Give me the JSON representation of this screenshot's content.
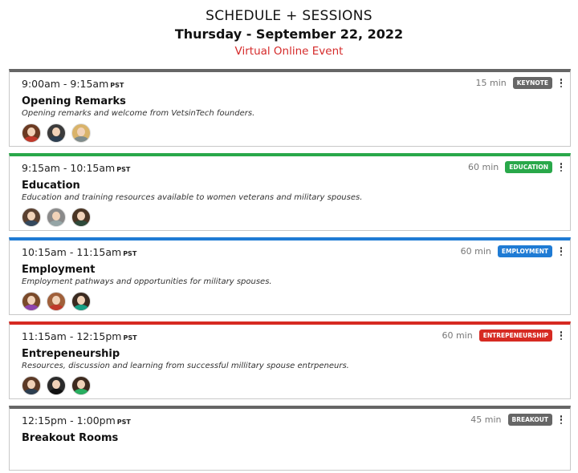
{
  "header": {
    "title": "SCHEDULE + SESSIONS",
    "date": "Thursday - September 22, 2022",
    "subtitle": "Virtual Online Event"
  },
  "sessions": [
    {
      "time": "9:00am - 9:15am",
      "tz": "PST",
      "duration": "15 min",
      "tag": "KEYNOTE",
      "tag_color": "#666666",
      "title": "Opening Remarks",
      "description": "Opening remarks and welcome from VetsinTech founders.",
      "speakers": 3
    },
    {
      "time": "9:15am - 10:15am",
      "tz": "PST",
      "duration": "60 min",
      "tag": "EDUCATION",
      "tag_color": "#29a84a",
      "title": "Education",
      "description": "Education and training resources available to women veterans and military spouses.",
      "speakers": 3
    },
    {
      "time": "10:15am - 11:15am",
      "tz": "PST",
      "duration": "60 min",
      "tag": "EMPLOYMENT",
      "tag_color": "#1f7bd4",
      "title": "Employment",
      "description": "Employment pathways and opportunities for military spouses.",
      "speakers": 3
    },
    {
      "time": "11:15am - 12:15pm",
      "tz": "PST",
      "duration": "60 min",
      "tag": "ENTREPENEURSHIP",
      "tag_color": "#d62a22",
      "title": "Entrepeneurship",
      "description": "Resources, discussion and learning from successful millitary spouse entrpeneurs.",
      "speakers": 3
    },
    {
      "time": "12:15pm - 1:00pm",
      "tz": "PST",
      "duration": "45 min",
      "tag": "BREAKOUT",
      "tag_color": "#666666",
      "title": "Breakout Rooms",
      "description": "",
      "speakers": 0
    }
  ],
  "colors": {
    "accent_red": "#d52b2b",
    "avatar_hair": [
      "#6b3a22",
      "#3b3b3b",
      "#d9b36a",
      "#5a4030",
      "#8a8a8a",
      "#4a3524",
      "#7a4a2a",
      "#a0603a",
      "#3a2a20",
      "#5c3a26",
      "#2b2b2b",
      "#3d2a1e"
    ],
    "avatar_shirt": [
      "#c0392b",
      "#2c3e50",
      "#7f8c8d",
      "#34495e",
      "#95a5a6",
      "#2e4a3a",
      "#8e44ad",
      "#c0392b",
      "#16a085",
      "#2c3e50",
      "#111111",
      "#27ae60"
    ]
  }
}
